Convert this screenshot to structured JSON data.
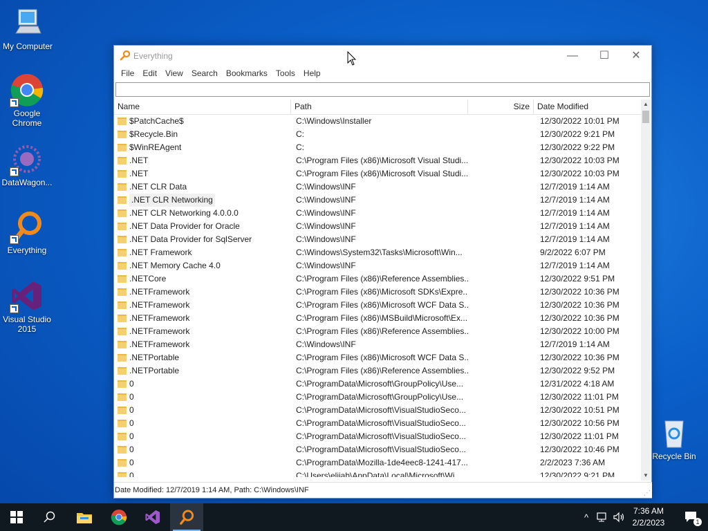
{
  "desktop": {
    "icons": [
      {
        "label": "My Computer"
      },
      {
        "label": "Google Chrome"
      },
      {
        "label": "DataWagon..."
      },
      {
        "label": "Everything"
      },
      {
        "label": "Visual Studio 2015"
      },
      {
        "label": "Recycle Bin"
      }
    ]
  },
  "window": {
    "title": "Everything",
    "minimize": "—",
    "maximize": "☐",
    "close": "✕",
    "menu": [
      "File",
      "Edit",
      "View",
      "Search",
      "Bookmarks",
      "Tools",
      "Help"
    ],
    "search": {
      "value": "",
      "placeholder": ""
    },
    "columns": {
      "name": "Name",
      "path": "Path",
      "size": "Size",
      "date": "Date Modified"
    },
    "rows": [
      {
        "name": "$PatchCache$",
        "path": "C:\\Windows\\Installer",
        "size": "",
        "date": "12/30/2022 10:01 PM"
      },
      {
        "name": "$Recycle.Bin",
        "path": "C:",
        "size": "",
        "date": "12/30/2022 9:21 PM"
      },
      {
        "name": "$WinREAgent",
        "path": "C:",
        "size": "",
        "date": "12/30/2022 9:22 PM"
      },
      {
        "name": ".NET",
        "path": "C:\\Program Files (x86)\\Microsoft Visual Studi...",
        "size": "",
        "date": "12/30/2022 10:03 PM"
      },
      {
        "name": ".NET",
        "path": "C:\\Program Files (x86)\\Microsoft Visual Studi...",
        "size": "",
        "date": "12/30/2022 10:03 PM"
      },
      {
        "name": ".NET CLR Data",
        "path": "C:\\Windows\\INF",
        "size": "",
        "date": "12/7/2019 1:14 AM"
      },
      {
        "name": ".NET CLR Networking",
        "path": "C:\\Windows\\INF",
        "size": "",
        "date": "12/7/2019 1:14 AM"
      },
      {
        "name": ".NET CLR Networking 4.0.0.0",
        "path": "C:\\Windows\\INF",
        "size": "",
        "date": "12/7/2019 1:14 AM"
      },
      {
        "name": ".NET Data Provider for Oracle",
        "path": "C:\\Windows\\INF",
        "size": "",
        "date": "12/7/2019 1:14 AM"
      },
      {
        "name": ".NET Data Provider for SqlServer",
        "path": "C:\\Windows\\INF",
        "size": "",
        "date": "12/7/2019 1:14 AM"
      },
      {
        "name": ".NET Framework",
        "path": "C:\\Windows\\System32\\Tasks\\Microsoft\\Win...",
        "size": "",
        "date": "9/2/2022 6:07 PM"
      },
      {
        "name": ".NET Memory Cache 4.0",
        "path": "C:\\Windows\\INF",
        "size": "",
        "date": "12/7/2019 1:14 AM"
      },
      {
        "name": ".NETCore",
        "path": "C:\\Program Files (x86)\\Reference Assemblies...",
        "size": "",
        "date": "12/30/2022 9:51 PM"
      },
      {
        "name": ".NETFramework",
        "path": "C:\\Program Files (x86)\\Microsoft SDKs\\Expre...",
        "size": "",
        "date": "12/30/2022 10:36 PM"
      },
      {
        "name": ".NETFramework",
        "path": "C:\\Program Files (x86)\\Microsoft WCF Data S...",
        "size": "",
        "date": "12/30/2022 10:36 PM"
      },
      {
        "name": ".NETFramework",
        "path": "C:\\Program Files (x86)\\MSBuild\\Microsoft\\Ex...",
        "size": "",
        "date": "12/30/2022 10:36 PM"
      },
      {
        "name": ".NETFramework",
        "path": "C:\\Program Files (x86)\\Reference Assemblies...",
        "size": "",
        "date": "12/30/2022 10:00 PM"
      },
      {
        "name": ".NETFramework",
        "path": "C:\\Windows\\INF",
        "size": "",
        "date": "12/7/2019 1:14 AM"
      },
      {
        "name": ".NETPortable",
        "path": "C:\\Program Files (x86)\\Microsoft WCF Data S...",
        "size": "",
        "date": "12/30/2022 10:36 PM"
      },
      {
        "name": ".NETPortable",
        "path": "C:\\Program Files (x86)\\Reference Assemblies...",
        "size": "",
        "date": "12/30/2022 9:52 PM"
      },
      {
        "name": "0",
        "path": "C:\\ProgramData\\Microsoft\\GroupPolicy\\Use...",
        "size": "",
        "date": "12/31/2022 4:18 AM"
      },
      {
        "name": "0",
        "path": "C:\\ProgramData\\Microsoft\\GroupPolicy\\Use...",
        "size": "",
        "date": "12/30/2022 11:01 PM"
      },
      {
        "name": "0",
        "path": "C:\\ProgramData\\Microsoft\\VisualStudioSeco...",
        "size": "",
        "date": "12/30/2022 10:51 PM"
      },
      {
        "name": "0",
        "path": "C:\\ProgramData\\Microsoft\\VisualStudioSeco...",
        "size": "",
        "date": "12/30/2022 10:56 PM"
      },
      {
        "name": "0",
        "path": "C:\\ProgramData\\Microsoft\\VisualStudioSeco...",
        "size": "",
        "date": "12/30/2022 11:01 PM"
      },
      {
        "name": "0",
        "path": "C:\\ProgramData\\Microsoft\\VisualStudioSeco...",
        "size": "",
        "date": "12/30/2022 10:46 PM"
      },
      {
        "name": "0",
        "path": "C:\\ProgramData\\Mozilla-1de4eec8-1241-417...",
        "size": "",
        "date": "2/2/2023 7:36 AM"
      },
      {
        "name": "0",
        "path": "C:\\Users\\elijah\\AppData\\Local\\Microsoft\\Wi...",
        "size": "",
        "date": "12/30/2022 9:21 PM"
      }
    ],
    "status": "Date Modified: 12/7/2019 1:14 AM, Path: C:\\Windows\\INF"
  },
  "taskbar": {
    "clock": {
      "time": "7:36 AM",
      "date": "2/2/2023"
    },
    "notification_count": "1",
    "tray_chevron": "^"
  },
  "colors": {
    "desktop": "#0a5fc8",
    "taskbar": "#101820",
    "everything_orange": "#f08a1c",
    "folder": "#f4d070"
  }
}
